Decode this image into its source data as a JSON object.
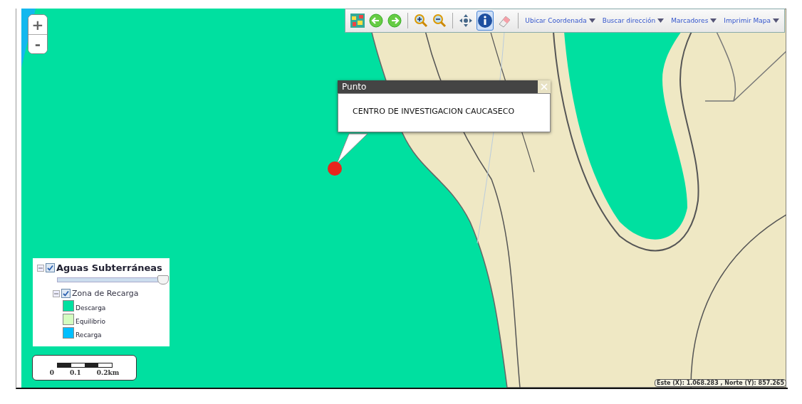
{
  "map": {
    "zoom_buttons": [
      {
        "label": "+"
      },
      {
        "label": "-"
      }
    ],
    "toolbar": {
      "tools": [
        {
          "kind": "layers",
          "selected": false
        },
        {
          "kind": "back",
          "selected": false
        },
        {
          "kind": "forward",
          "selected": false
        },
        {
          "kind": "sep"
        },
        {
          "kind": "zoom-in",
          "selected": false
        },
        {
          "kind": "zoom-out",
          "selected": false
        },
        {
          "kind": "sep"
        },
        {
          "kind": "pan",
          "selected": false
        },
        {
          "kind": "info",
          "selected": true
        },
        {
          "kind": "eraser",
          "selected": false
        },
        {
          "kind": "sep"
        }
      ],
      "menus": [
        {
          "label": "Ubicar Coordenada"
        },
        {
          "label": "Buscar dirección"
        },
        {
          "label": "Marcadores"
        },
        {
          "label": "Imprimir Mapa"
        }
      ]
    },
    "popup": {
      "title": "Punto",
      "text": "CENTRO DE INVESTIGACION CAUCASECO"
    },
    "legend": {
      "title": "Aguas Subterráneas",
      "checked": true,
      "expanded": true,
      "level": 0.97,
      "children": [
        {
          "title": "Zona de Recarga",
          "checked": true,
          "expanded": true,
          "classes": [
            {
              "label": "Descarga",
              "color": "#00e0a0"
            },
            {
              "label": "Equilibrio",
              "color": "#d4fcc0"
            },
            {
              "label": "Recarga",
              "color": "#00bfff"
            }
          ]
        }
      ]
    },
    "scale": {
      "labels": [
        "0",
        "0.1",
        "0.2km"
      ]
    },
    "coordinates": "Este (X): 1.068.283 , Norte (Y): 857.265"
  }
}
